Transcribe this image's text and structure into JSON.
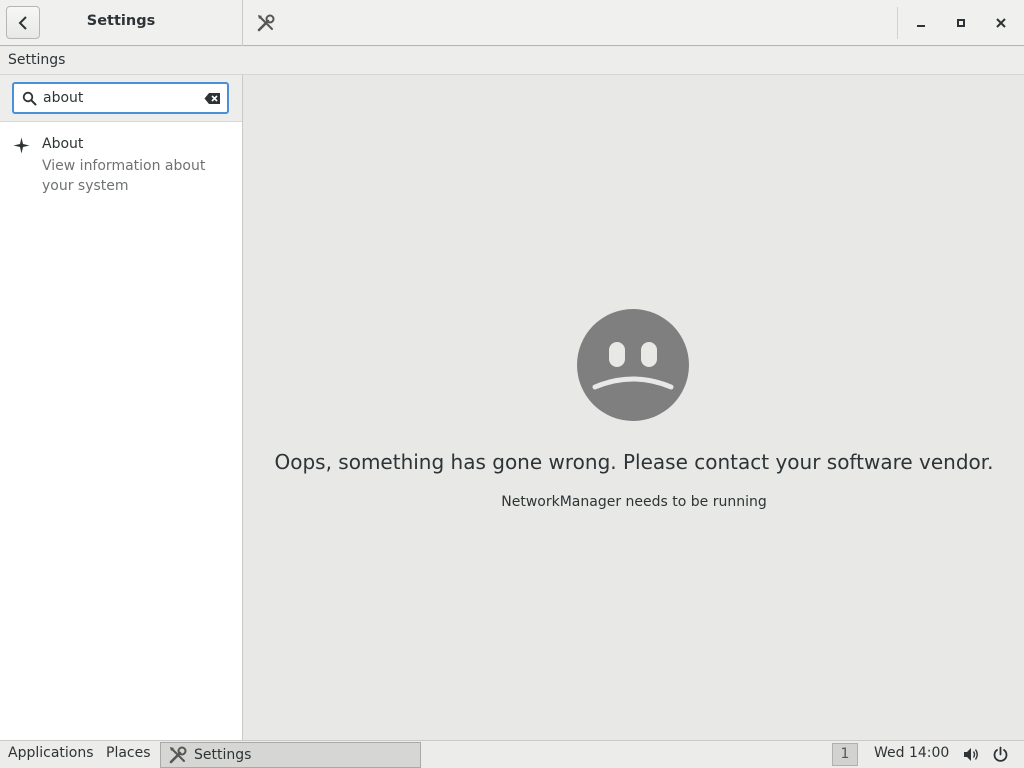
{
  "header": {
    "title": "Settings",
    "back_icon": "chevron-left-icon",
    "app_icon": "tools-icon",
    "window_controls": [
      "minimize-icon",
      "maximize-icon",
      "close-icon"
    ]
  },
  "menubar": {
    "label": "Settings"
  },
  "sidebar": {
    "search": {
      "value": "about",
      "placeholder": ""
    },
    "results": [
      {
        "title": "About",
        "description": "View information about your system",
        "icon": "sparkle-icon"
      }
    ]
  },
  "main": {
    "error_title": "Oops, something has gone wrong. Please contact your software vendor.",
    "error_detail": "NetworkManager needs to be running",
    "icon": "sad-face-icon"
  },
  "taskbar": {
    "applications": "Applications",
    "places": "Places",
    "window_label": "Settings",
    "workspace": "1",
    "clock": "Wed 14:00"
  },
  "colors": {
    "accent": "#4a90d9",
    "face": "#7f7f7f"
  }
}
